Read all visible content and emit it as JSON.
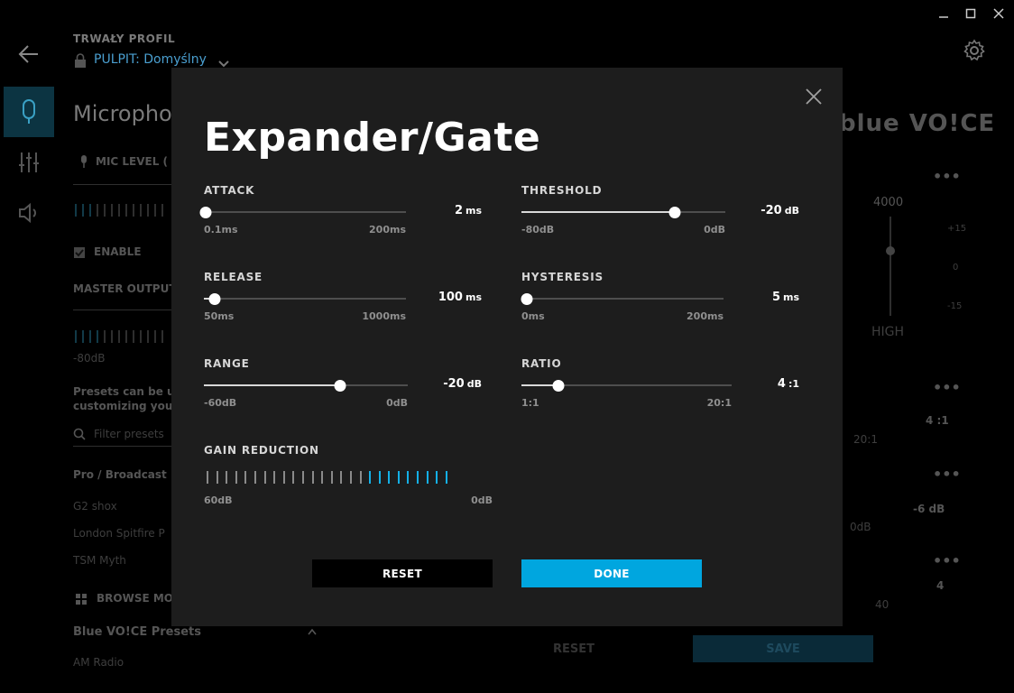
{
  "background": {
    "profile_label": "TRWAŁY PROFIL",
    "profile_name": "PULPIT: Domyślny",
    "page_title": "Micropho",
    "mic_level": "MIC LEVEL (",
    "enable": "ENABLE",
    "master_output": "MASTER OUTPUT",
    "db_80": "-80dB",
    "presets_desc_1": "Presets can be u",
    "presets_desc_2": "customizing your",
    "filter_placeholder": "Filter presets",
    "pro_broadcast": "Pro / Broadcast",
    "preset_1": "G2 shox",
    "preset_2": "London Spitfire P",
    "preset_3": "TSM Myth",
    "browse_more": "BROWSE MOR",
    "blue_voice_presets": "Blue VO!CE Presets",
    "am_radio": "AM Radio",
    "freq_4000": "4000",
    "plus15": "+15",
    "zero": "0",
    "minus15": "-15",
    "high": "HIGH",
    "ratio_val": "4 :1",
    "ratio_max": "20:1",
    "db_minus6": "-6 dB",
    "zero_db": "0dB",
    "four": "4",
    "forty": "40",
    "reset_label": "RESET",
    "save_label": "SAVE",
    "blue_voice_logo": "blue VO!CE"
  },
  "modal": {
    "title": "Expander/Gate",
    "controls": {
      "attack": {
        "label": "ATTACK",
        "min": "0.1ms",
        "max": "200ms",
        "value": "2",
        "unit": "ms",
        "fraction": 0.01
      },
      "release": {
        "label": "RELEASE",
        "min": "50ms",
        "max": "1000ms",
        "value": "100",
        "unit": "ms",
        "fraction": 0.053
      },
      "range": {
        "label": "RANGE",
        "min": "-60dB",
        "max": "0dB",
        "value": "-20",
        "unit": "dB",
        "fraction": 0.667
      },
      "threshold": {
        "label": "THRESHOLD",
        "min": "-80dB",
        "max": "0dB",
        "value": "-20",
        "unit": "dB",
        "fraction": 0.75
      },
      "hysteresis": {
        "label": "HYSTERESIS",
        "min": "0ms",
        "max": "200ms",
        "value": "5",
        "unit": "ms",
        "fraction": 0.025
      },
      "ratio": {
        "label": "RATIO",
        "min": "1:1",
        "max": "20:1",
        "value": "4",
        "unit": ":1",
        "fraction": 0.175
      }
    },
    "gain_reduction": {
      "label": "GAIN REDUCTION",
      "min": "60dB",
      "max": "0dB",
      "total_ticks": 26,
      "active_ticks": 9
    },
    "buttons": {
      "reset": "RESET",
      "done": "DONE"
    }
  },
  "colors": {
    "accent": "#00a6df",
    "modal_bg": "#1d1d1d"
  }
}
